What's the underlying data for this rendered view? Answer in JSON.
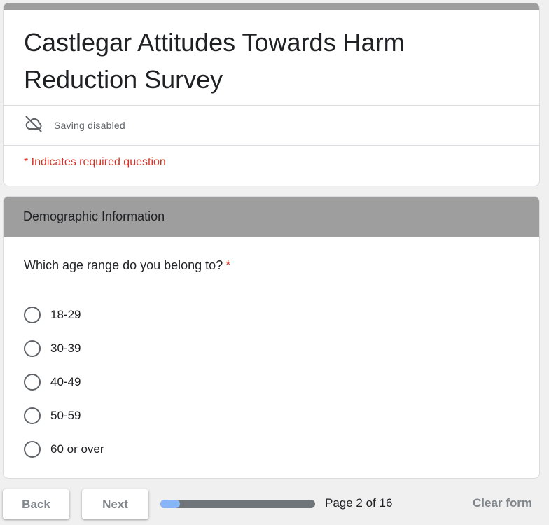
{
  "form": {
    "title": "Castlegar Attitudes Towards Harm Reduction Survey",
    "saving_status": "Saving disabled",
    "saving_icon": "cloud-off-icon",
    "required_note": "* Indicates required question"
  },
  "section": {
    "title": "Demographic Information"
  },
  "question": {
    "text": "Which age range do you belong to?",
    "required_marker": "*",
    "options": [
      {
        "label": "18-29",
        "selected": false
      },
      {
        "label": "30-39",
        "selected": false
      },
      {
        "label": "40-49",
        "selected": false
      },
      {
        "label": "50-59",
        "selected": false
      },
      {
        "label": "60 or over",
        "selected": false
      }
    ]
  },
  "footer": {
    "back_label": "Back",
    "next_label": "Next",
    "page_indicator": "Page 2 of 16",
    "progress_fraction": 0.125,
    "clear_label": "Clear form"
  },
  "colors": {
    "header_gray": "#9e9e9e",
    "required_red": "#d93025",
    "progress_fill": "#8ab4f8",
    "progress_track": "#70757a"
  }
}
